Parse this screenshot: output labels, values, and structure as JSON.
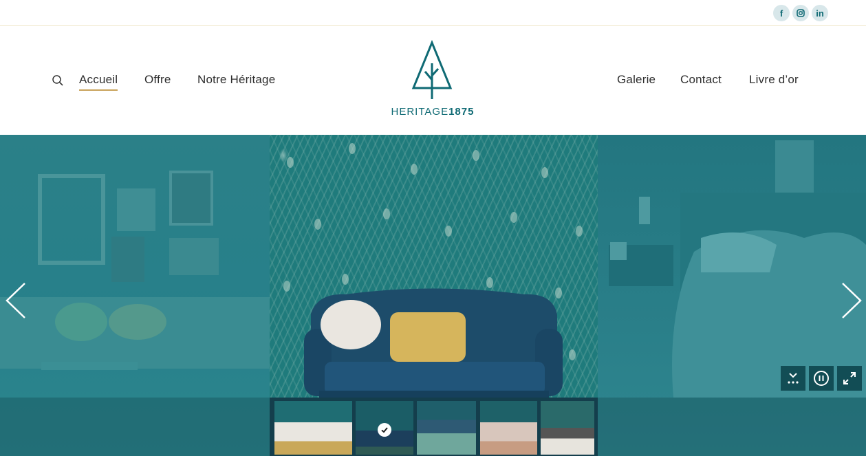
{
  "social": [
    {
      "icon": "facebook-icon",
      "label": "f"
    },
    {
      "icon": "instagram-icon",
      "label": ""
    },
    {
      "icon": "linkedin-icon",
      "label": "in"
    }
  ],
  "nav": {
    "left": [
      "Accueil",
      "Offre",
      "Notre Héritage"
    ],
    "right": [
      "Galerie",
      "Contact",
      "Livre d’or"
    ],
    "active": "Accueil"
  },
  "logo": {
    "text_light": "HERITAGE",
    "text_bold": "1875"
  },
  "colors": {
    "brand_teal": "#0f6a74",
    "accent_gold": "#c9a25a",
    "slider_overlay": "#1b6f78"
  },
  "slider": {
    "thumbnail_count": 5,
    "selected_thumbnail": 2,
    "controls": [
      "expand-thumbnails-icon",
      "pause-icon",
      "fullscreen-icon"
    ]
  }
}
